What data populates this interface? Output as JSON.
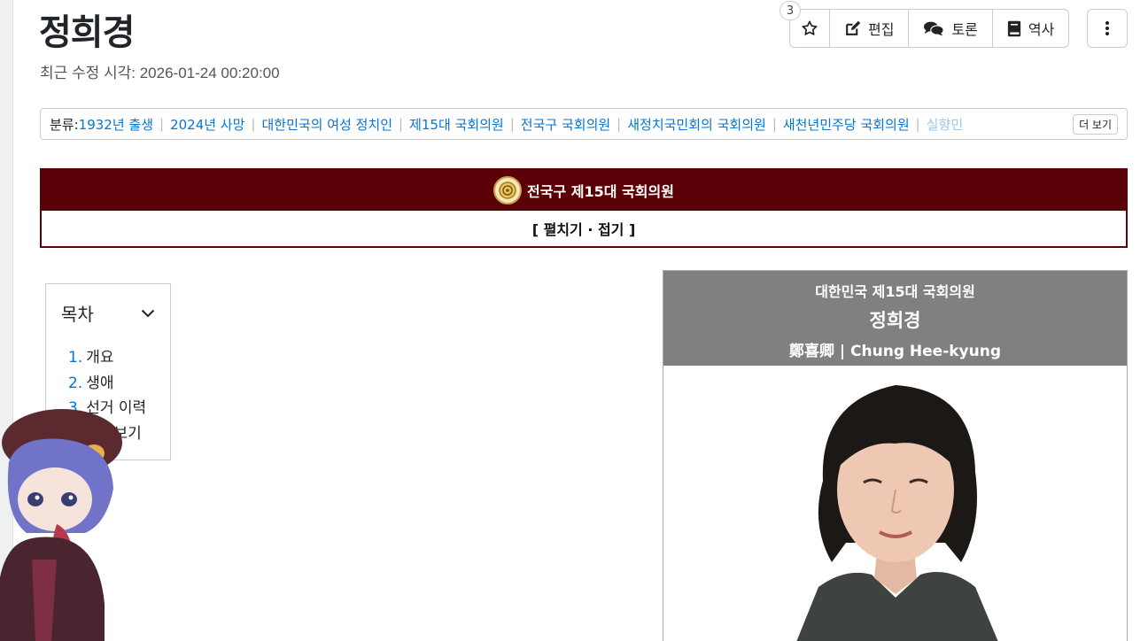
{
  "article": {
    "title": "정희경",
    "last_modified": "최근 수정 시각: 2026-01-24 00:20:00"
  },
  "actions": {
    "star_count": "3",
    "edit_label": "편집",
    "discuss_label": "토론",
    "history_label": "역사"
  },
  "categories": {
    "label": "분류:",
    "items": [
      "1932년 출생",
      "2024년 사망",
      "대한민국의 여성 정치인",
      "제15대 국회의원",
      "전국구 국회의원",
      "새정치국민회의 국회의원",
      "새천년민주당 국회의원",
      "실향민"
    ],
    "more_label": "더 보기"
  },
  "navbox": {
    "title": "전국구 제15대 국회의원",
    "toggle_label": "[ 펼치기 · 접기 ]"
  },
  "toc": {
    "title": "목차",
    "items": [
      {
        "num": "1.",
        "label": "개요"
      },
      {
        "num": "2.",
        "label": "생애"
      },
      {
        "num": "3.",
        "label": "선거 이력"
      },
      {
        "num": "4.",
        "label": "둘러보기"
      }
    ]
  },
  "infobox": {
    "subtitle": "대한민국 제15대 국회의원",
    "name": "정희경",
    "romanized": "鄭喜卿 | Chung Hee-kyung"
  },
  "colors": {
    "accent_link": "#0275d8",
    "navbox_bg": "#5c0008",
    "infobox_header_bg": "#808080"
  }
}
